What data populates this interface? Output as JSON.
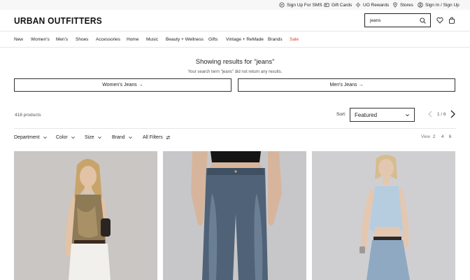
{
  "utility_bar": {
    "sms": "Sign Up For SMS",
    "gift_cards": "Gift Cards",
    "rewards": "UO Rewards",
    "stores": "Stores",
    "account": "Sign In / Sign Up"
  },
  "header": {
    "logo": "URBAN OUTFITTERS",
    "search_value": "jeans",
    "icons": [
      "search-icon",
      "heart-icon",
      "bag-icon"
    ]
  },
  "nav": {
    "items": [
      "New",
      "Women's",
      "Men's",
      "Shoes",
      "Accessories",
      "Home",
      "Music",
      "Beauty + Wellness",
      "Gifts",
      "Vintage + ReMade",
      "Brands",
      "Sale"
    ],
    "sale_color": "#d8412f"
  },
  "results": {
    "title": "Showing results for “jeans”",
    "subtitle": "Your search term “jeans” did not return any results.",
    "buttons": [
      "Women's Jeans →",
      "Men's Jeans →"
    ]
  },
  "listing": {
    "count": "418 products",
    "sort_label": "Sort:",
    "sort_value": "Featured",
    "page_text": "1 / 6"
  },
  "filters": {
    "items": [
      "Department",
      "Color",
      "Size",
      "Brand",
      "All Filters"
    ],
    "view_label": "View",
    "view_options": [
      "2",
      "4",
      "6"
    ]
  },
  "products": [
    {
      "name": "product-card-1"
    },
    {
      "name": "product-card-2"
    },
    {
      "name": "product-card-3"
    }
  ]
}
